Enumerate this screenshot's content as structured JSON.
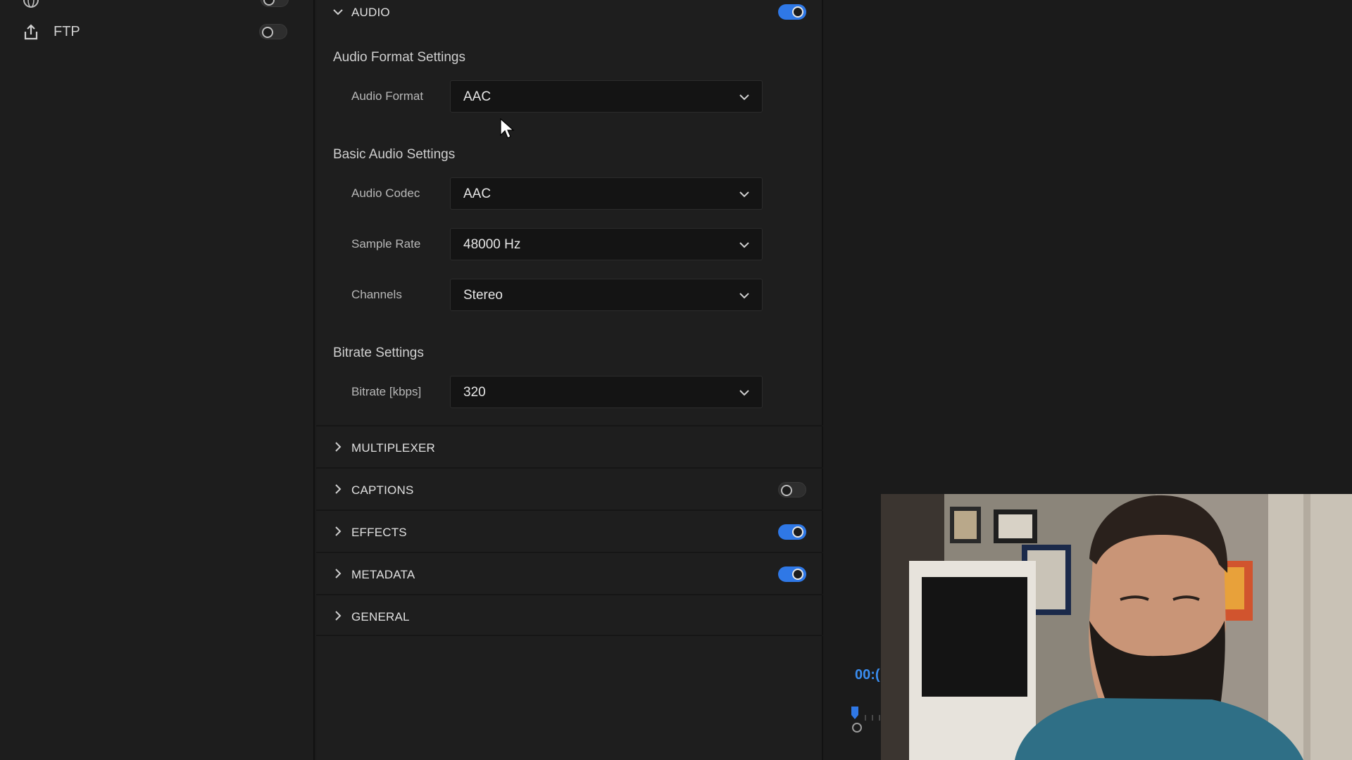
{
  "sidebar": {
    "items": [
      {
        "label": "",
        "icon": "globe-icon",
        "enabled": false
      },
      {
        "label": "FTP",
        "icon": "upload-icon",
        "enabled": false
      }
    ]
  },
  "audio_section": {
    "title": "AUDIO",
    "enabled": true,
    "groups": {
      "format": {
        "title": "Audio Format Settings",
        "fields": [
          {
            "label": "Audio Format",
            "value": "AAC"
          }
        ]
      },
      "basic": {
        "title": "Basic Audio Settings",
        "fields": [
          {
            "label": "Audio Codec",
            "value": "AAC"
          },
          {
            "label": "Sample Rate",
            "value": "48000 Hz"
          },
          {
            "label": "Channels",
            "value": "Stereo"
          }
        ]
      },
      "bitrate": {
        "title": "Bitrate Settings",
        "fields": [
          {
            "label": "Bitrate [kbps]",
            "value": "320"
          }
        ]
      }
    }
  },
  "sections": [
    {
      "title": "MULTIPLEXER",
      "has_toggle": false
    },
    {
      "title": "CAPTIONS",
      "has_toggle": true,
      "enabled": false
    },
    {
      "title": "EFFECTS",
      "has_toggle": true,
      "enabled": true
    },
    {
      "title": "METADATA",
      "has_toggle": true,
      "enabled": true
    },
    {
      "title": "GENERAL",
      "has_toggle": false
    }
  ],
  "preview": {
    "timecode": "00:("
  },
  "colors": {
    "accent": "#2f78e6",
    "timecode": "#3a8df0",
    "background": "#1b1b1b"
  }
}
